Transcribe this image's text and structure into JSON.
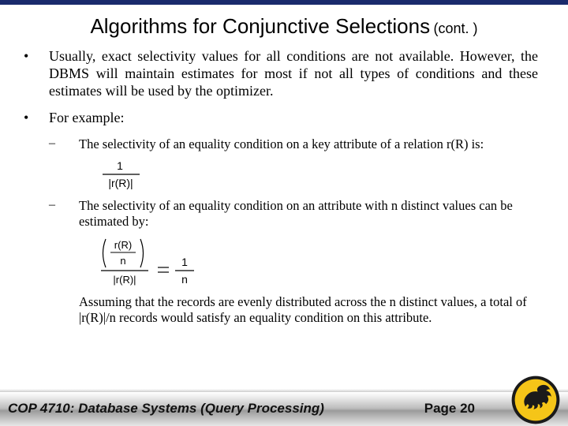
{
  "title": {
    "main": "Algorithms for Conjunctive Selections",
    "suffix": "(cont. )"
  },
  "bullets": {
    "b1": "Usually, exact selectivity values for all conditions are not available. However, the DBMS will maintain estimates for most if not all types of conditions and these estimates will be used by the optimizer.",
    "b2": "For example:",
    "s1": "The selectivity of an equality condition on a key attribute of a relation r(R) is:",
    "s2": "The selectivity of an equality condition on an attribute with n distinct values can be estimated by:",
    "closing": "Assuming that the records are evenly distributed across the n distinct values, a total of |r(R)|/n records would satisfy an equality condition on this attribute."
  },
  "formulas": {
    "f1": {
      "numerator": "1",
      "denominator": "|r(R)|"
    },
    "f2": {
      "left_numerator_top": "r(R)",
      "left_numerator_bottom": "n",
      "left_denominator": "|r(R)|",
      "right_numerator": "1",
      "right_denominator": "n"
    }
  },
  "footer": {
    "course": "COP 4710: Database Systems (Query Processing)",
    "page": "Page 20"
  }
}
